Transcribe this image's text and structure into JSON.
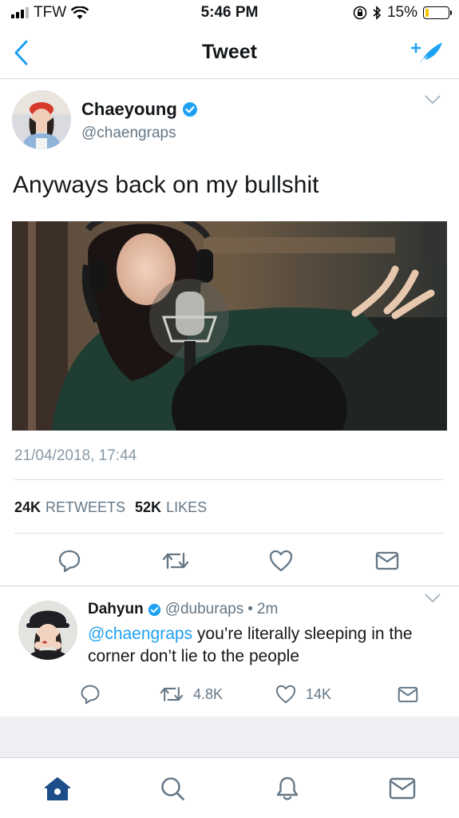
{
  "status_bar": {
    "carrier": "TFW",
    "time": "5:46 PM",
    "battery_percent": "15%",
    "battery_level": 0.15
  },
  "nav": {
    "title": "Tweet",
    "back_icon": "chevron-left-icon",
    "compose_icon": "compose-feather-icon"
  },
  "tweet": {
    "author_name": "Chaeyoung",
    "author_handle": "@chaengraps",
    "verified": true,
    "text": "Anyways back on my bullshit",
    "timestamp": "21/04/2018, 17:44",
    "retweets_count": "24K",
    "retweets_label": "RETWEETS",
    "likes_count": "52K",
    "likes_label": "LIKES"
  },
  "reply": {
    "author_name": "Dahyun",
    "author_handle": "@duburaps",
    "separator": "•",
    "time": "2m",
    "verified": true,
    "mention": "@chaengraps",
    "text": " you’re literally sleeping in the corner don’t lie to the people",
    "retweets": "4.8K",
    "likes": "14K"
  },
  "tabs": [
    "home-icon",
    "search-icon",
    "notifications-bell-icon",
    "messages-envelope-icon"
  ],
  "colors": {
    "accent": "#1da1f2",
    "text": "#14171a",
    "muted": "#657786",
    "icon": "#657786",
    "tab_active": "#1d4e89"
  }
}
